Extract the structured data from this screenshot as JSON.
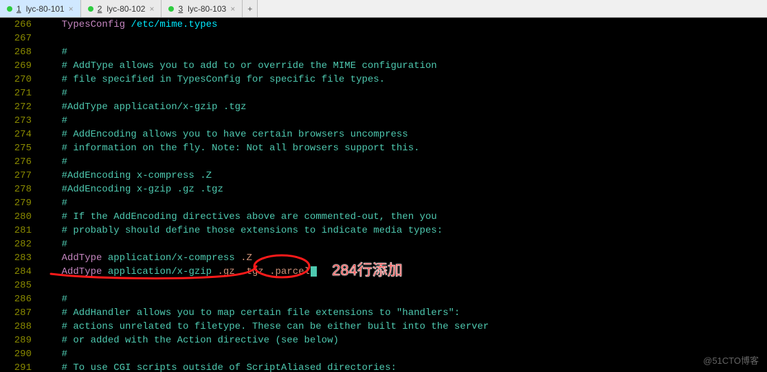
{
  "tabs": [
    {
      "num": "1",
      "label": "lyc-80-101",
      "dot": "green",
      "active": true
    },
    {
      "num": "2",
      "label": "lyc-80-102",
      "dot": "green",
      "active": false
    },
    {
      "num": "3",
      "label": "lyc-80-103",
      "dot": "green",
      "active": false
    }
  ],
  "addtab_glyph": "+",
  "close_glyph": "×",
  "annotation_text": "284行添加",
  "watermark": "@51CTO博客",
  "lines": [
    {
      "n": "266",
      "tokens": [
        {
          "cls": "c-dir",
          "t": "    TypesConfig "
        },
        {
          "cls": "c-cyan",
          "t": "/etc/mime.types"
        }
      ]
    },
    {
      "n": "267",
      "tokens": []
    },
    {
      "n": "268",
      "tokens": [
        {
          "cls": "c-comment",
          "t": "    #"
        }
      ]
    },
    {
      "n": "269",
      "tokens": [
        {
          "cls": "c-comment",
          "t": "    # AddType allows you to add to or override the MIME configuration"
        }
      ]
    },
    {
      "n": "270",
      "tokens": [
        {
          "cls": "c-comment",
          "t": "    # file specified in TypesConfig for specific file types."
        }
      ]
    },
    {
      "n": "271",
      "tokens": [
        {
          "cls": "c-comment",
          "t": "    #"
        }
      ]
    },
    {
      "n": "272",
      "tokens": [
        {
          "cls": "c-comment",
          "t": "    #AddType application/x-gzip .tgz"
        }
      ]
    },
    {
      "n": "273",
      "tokens": [
        {
          "cls": "c-comment",
          "t": "    #"
        }
      ]
    },
    {
      "n": "274",
      "tokens": [
        {
          "cls": "c-comment",
          "t": "    # AddEncoding allows you to have certain browsers uncompress"
        }
      ]
    },
    {
      "n": "275",
      "tokens": [
        {
          "cls": "c-comment",
          "t": "    # information on the fly. Note: Not all browsers support this."
        }
      ]
    },
    {
      "n": "276",
      "tokens": [
        {
          "cls": "c-comment",
          "t": "    #"
        }
      ]
    },
    {
      "n": "277",
      "tokens": [
        {
          "cls": "c-comment",
          "t": "    #AddEncoding x-compress .Z"
        }
      ]
    },
    {
      "n": "278",
      "tokens": [
        {
          "cls": "c-comment",
          "t": "    #AddEncoding x-gzip .gz .tgz"
        }
      ]
    },
    {
      "n": "279",
      "tokens": [
        {
          "cls": "c-comment",
          "t": "    #"
        }
      ]
    },
    {
      "n": "280",
      "tokens": [
        {
          "cls": "c-comment",
          "t": "    # If the AddEncoding directives above are commented-out, then you"
        }
      ]
    },
    {
      "n": "281",
      "tokens": [
        {
          "cls": "c-comment",
          "t": "    # probably should define those extensions to indicate media types:"
        }
      ]
    },
    {
      "n": "282",
      "tokens": [
        {
          "cls": "c-comment",
          "t": "    #"
        }
      ]
    },
    {
      "n": "283",
      "tokens": [
        {
          "cls": "c-dir",
          "t": "    AddType "
        },
        {
          "cls": "c-val",
          "t": "application/x-compress "
        },
        {
          "cls": "c-ext",
          "t": ".Z"
        }
      ]
    },
    {
      "n": "284",
      "tokens": [
        {
          "cls": "c-dir",
          "t": "    AddType "
        },
        {
          "cls": "c-val",
          "t": "application/x-gzip "
        },
        {
          "cls": "c-ext",
          "t": ".gz "
        },
        {
          "cls": "c-ext",
          "t": ".tgz "
        },
        {
          "cls": "c-ext",
          "t": ".parcel"
        }
      ],
      "cursor": true
    },
    {
      "n": "285",
      "tokens": []
    },
    {
      "n": "286",
      "tokens": [
        {
          "cls": "c-comment",
          "t": "    #"
        }
      ]
    },
    {
      "n": "287",
      "tokens": [
        {
          "cls": "c-comment",
          "t": "    # AddHandler allows you to map certain file extensions to \"handlers\":"
        }
      ]
    },
    {
      "n": "288",
      "tokens": [
        {
          "cls": "c-comment",
          "t": "    # actions unrelated to filetype. These can be either built into the server"
        }
      ]
    },
    {
      "n": "289",
      "tokens": [
        {
          "cls": "c-comment",
          "t": "    # or added with the Action directive (see below)"
        }
      ]
    },
    {
      "n": "290",
      "tokens": [
        {
          "cls": "c-comment",
          "t": "    #"
        }
      ]
    },
    {
      "n": "291",
      "tokens": [
        {
          "cls": "c-comment",
          "t": "    # To use CGI scripts outside of ScriptAliased directories:"
        }
      ]
    }
  ]
}
